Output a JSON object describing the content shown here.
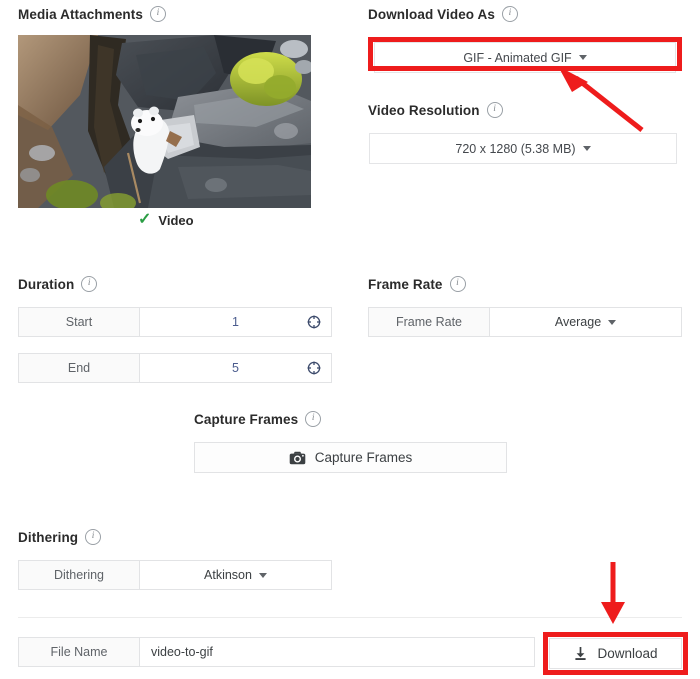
{
  "media": {
    "heading": "Media Attachments",
    "info_icon": "info-icon",
    "thumbnail_alt": "stoat on rocks video thumbnail",
    "badge": "Video",
    "badge_icon": "check-icon",
    "badge_color": "#2a9d44"
  },
  "download_as": {
    "heading": "Download Video As",
    "info_icon": "info-icon",
    "selected": "GIF - Animated GIF",
    "caret_icon": "chevron-down-icon",
    "highlight_color": "#ee1c1c"
  },
  "resolution": {
    "heading": "Video Resolution",
    "info_icon": "info-icon",
    "selected": "720 x 1280 (5.38 MB)",
    "caret_icon": "chevron-down-icon"
  },
  "duration": {
    "heading": "Duration",
    "info_icon": "info-icon",
    "rows": [
      {
        "label": "Start",
        "value": "1",
        "icon": "crosshair-icon"
      },
      {
        "label": "End",
        "value": "5",
        "icon": "crosshair-icon"
      }
    ]
  },
  "frame_rate": {
    "heading": "Frame Rate",
    "info_icon": "info-icon",
    "label": "Frame Rate",
    "selected": "Average",
    "caret_icon": "chevron-down-icon"
  },
  "capture_frames": {
    "heading": "Capture Frames",
    "info_icon": "info-icon",
    "button_label": "Capture Frames",
    "button_icon": "camera-icon"
  },
  "dithering": {
    "heading": "Dithering",
    "info_icon": "info-icon",
    "label": "Dithering",
    "selected": "Atkinson",
    "caret_icon": "chevron-down-icon"
  },
  "footer": {
    "file_name_label": "File Name",
    "file_name_value": "video-to-gif",
    "download_label": "Download",
    "download_icon": "download-icon",
    "highlight_color": "#ee1c1c"
  }
}
